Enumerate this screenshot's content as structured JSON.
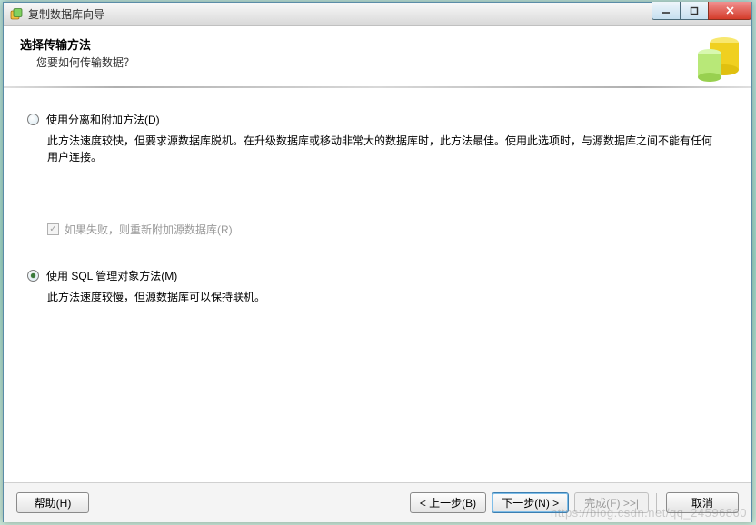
{
  "window": {
    "title": "复制数据库向导"
  },
  "header": {
    "title": "选择传输方法",
    "subtitle": "您要如何传输数据？"
  },
  "option1": {
    "label": "使用分离和附加方法(D)",
    "desc": "此方法速度较快，但要求源数据库脱机。在升级数据库或移动非常大的数据库时，此方法最佳。使用此选项时，与源数据库之间不能有任何用户连接。",
    "sub_check_label": "如果失败，则重新附加源数据库(R)",
    "selected": false,
    "sub_checked": true,
    "sub_disabled": true
  },
  "option2": {
    "label": "使用 SQL 管理对象方法(M)",
    "desc": "此方法速度较慢，但源数据库可以保持联机。",
    "selected": true
  },
  "buttons": {
    "help": "帮助(H)",
    "back": "< 上一步(B)",
    "next": "下一步(N) >",
    "finish": "完成(F) >>|",
    "cancel": "取消"
  },
  "watermark": "https://blog.csdn.net/qq_24596860"
}
